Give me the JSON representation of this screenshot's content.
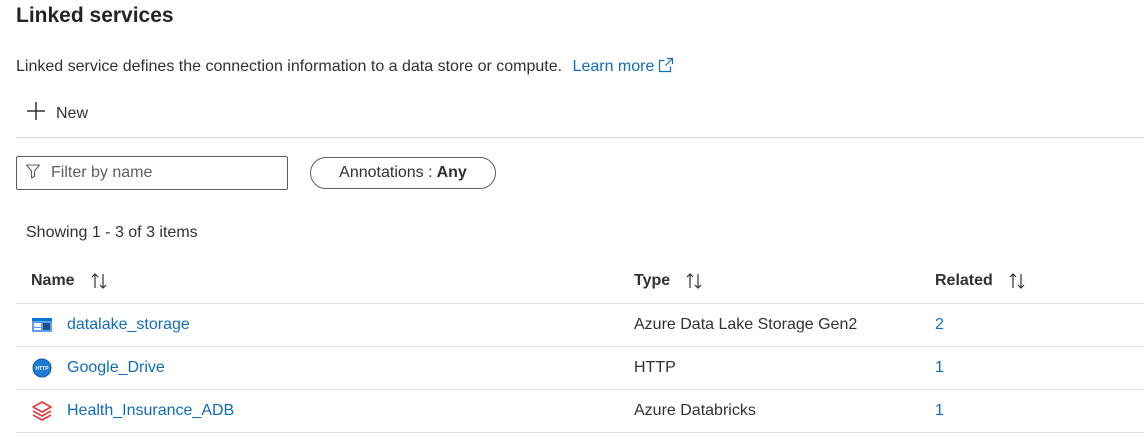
{
  "header": {
    "title": "Linked services",
    "description": "Linked service defines the connection information to a data store or compute.",
    "learn_more": "Learn more"
  },
  "toolbar": {
    "new_label": "New"
  },
  "filter": {
    "placeholder": "Filter by name",
    "annotations_label": "Annotations :",
    "annotations_value": "Any"
  },
  "summary": "Showing 1 - 3 of 3 items",
  "table": {
    "columns": [
      "Name",
      "Type",
      "Related"
    ],
    "rows": [
      {
        "icon": "data-lake-storage-icon",
        "name": "datalake_storage",
        "type": "Azure Data Lake Storage Gen2",
        "related": "2"
      },
      {
        "icon": "http-icon",
        "name": "Google_Drive",
        "type": "HTTP",
        "related": "1"
      },
      {
        "icon": "databricks-icon",
        "name": "Health_Insurance_ADB",
        "type": "Azure Databricks",
        "related": "1"
      }
    ]
  },
  "colors": {
    "link": "#0f6cbd",
    "text": "#323130",
    "border": "#605e5c",
    "divider": "#e1dfdd",
    "databricks": "#e0383e",
    "http_icon": "#1f7ad6"
  }
}
